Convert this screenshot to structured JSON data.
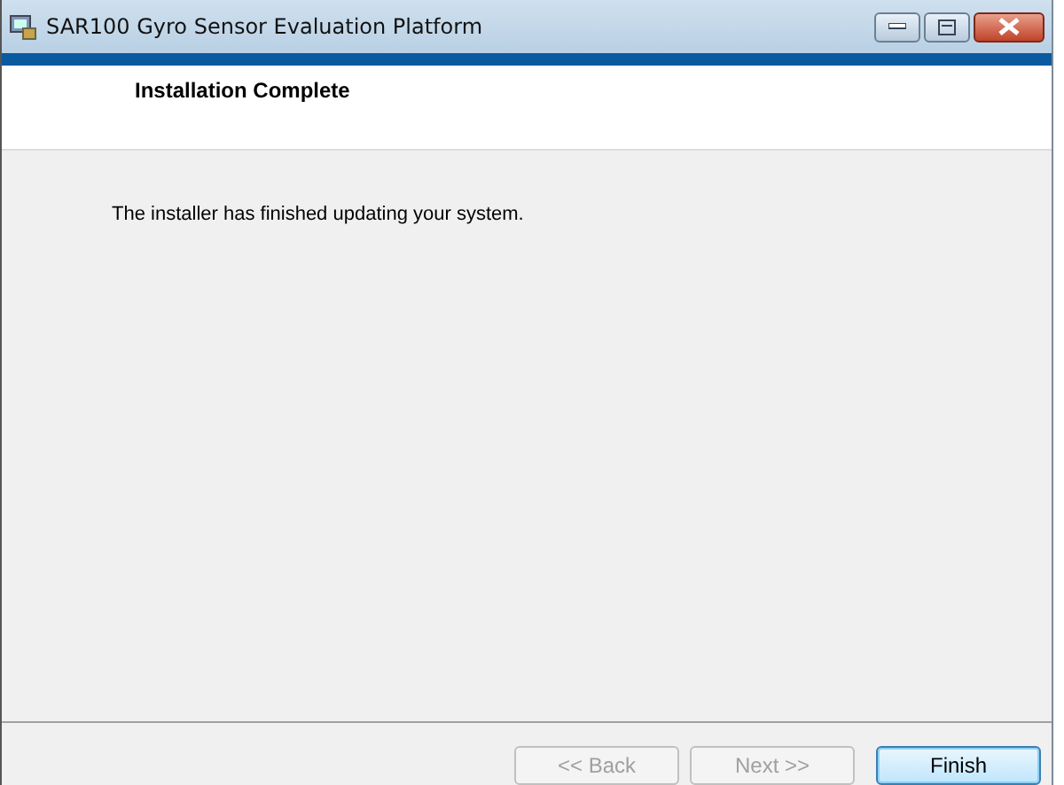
{
  "window": {
    "title": "SAR100 Gyro Sensor Evaluation Platform"
  },
  "header": {
    "title": "Installation Complete"
  },
  "body": {
    "message": "The installer has finished updating your system."
  },
  "buttons": [
    {
      "label": "<< Back",
      "disabled": true,
      "default": false
    },
    {
      "label": "Next >>",
      "disabled": true,
      "default": false
    },
    {
      "label": "Finish",
      "disabled": false,
      "default": true
    }
  ]
}
